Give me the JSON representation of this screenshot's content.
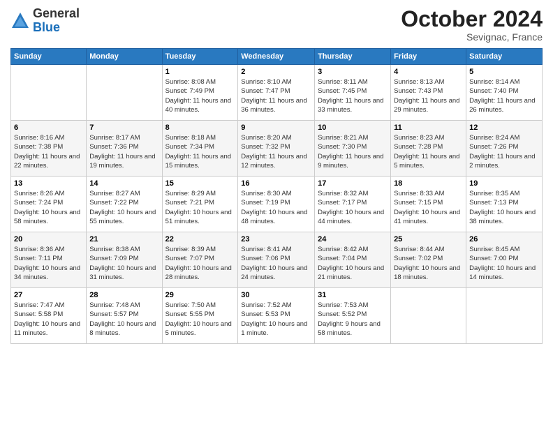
{
  "logo": {
    "general": "General",
    "blue": "Blue"
  },
  "title": "October 2024",
  "location": "Sevignac, France",
  "headers": [
    "Sunday",
    "Monday",
    "Tuesday",
    "Wednesday",
    "Thursday",
    "Friday",
    "Saturday"
  ],
  "weeks": [
    [
      {
        "day": "",
        "sunrise": "",
        "sunset": "",
        "daylight": ""
      },
      {
        "day": "",
        "sunrise": "",
        "sunset": "",
        "daylight": ""
      },
      {
        "day": "1",
        "sunrise": "Sunrise: 8:08 AM",
        "sunset": "Sunset: 7:49 PM",
        "daylight": "Daylight: 11 hours and 40 minutes."
      },
      {
        "day": "2",
        "sunrise": "Sunrise: 8:10 AM",
        "sunset": "Sunset: 7:47 PM",
        "daylight": "Daylight: 11 hours and 36 minutes."
      },
      {
        "day": "3",
        "sunrise": "Sunrise: 8:11 AM",
        "sunset": "Sunset: 7:45 PM",
        "daylight": "Daylight: 11 hours and 33 minutes."
      },
      {
        "day": "4",
        "sunrise": "Sunrise: 8:13 AM",
        "sunset": "Sunset: 7:43 PM",
        "daylight": "Daylight: 11 hours and 29 minutes."
      },
      {
        "day": "5",
        "sunrise": "Sunrise: 8:14 AM",
        "sunset": "Sunset: 7:40 PM",
        "daylight": "Daylight: 11 hours and 26 minutes."
      }
    ],
    [
      {
        "day": "6",
        "sunrise": "Sunrise: 8:16 AM",
        "sunset": "Sunset: 7:38 PM",
        "daylight": "Daylight: 11 hours and 22 minutes."
      },
      {
        "day": "7",
        "sunrise": "Sunrise: 8:17 AM",
        "sunset": "Sunset: 7:36 PM",
        "daylight": "Daylight: 11 hours and 19 minutes."
      },
      {
        "day": "8",
        "sunrise": "Sunrise: 8:18 AM",
        "sunset": "Sunset: 7:34 PM",
        "daylight": "Daylight: 11 hours and 15 minutes."
      },
      {
        "day": "9",
        "sunrise": "Sunrise: 8:20 AM",
        "sunset": "Sunset: 7:32 PM",
        "daylight": "Daylight: 11 hours and 12 minutes."
      },
      {
        "day": "10",
        "sunrise": "Sunrise: 8:21 AM",
        "sunset": "Sunset: 7:30 PM",
        "daylight": "Daylight: 11 hours and 9 minutes."
      },
      {
        "day": "11",
        "sunrise": "Sunrise: 8:23 AM",
        "sunset": "Sunset: 7:28 PM",
        "daylight": "Daylight: 11 hours and 5 minutes."
      },
      {
        "day": "12",
        "sunrise": "Sunrise: 8:24 AM",
        "sunset": "Sunset: 7:26 PM",
        "daylight": "Daylight: 11 hours and 2 minutes."
      }
    ],
    [
      {
        "day": "13",
        "sunrise": "Sunrise: 8:26 AM",
        "sunset": "Sunset: 7:24 PM",
        "daylight": "Daylight: 10 hours and 58 minutes."
      },
      {
        "day": "14",
        "sunrise": "Sunrise: 8:27 AM",
        "sunset": "Sunset: 7:22 PM",
        "daylight": "Daylight: 10 hours and 55 minutes."
      },
      {
        "day": "15",
        "sunrise": "Sunrise: 8:29 AM",
        "sunset": "Sunset: 7:21 PM",
        "daylight": "Daylight: 10 hours and 51 minutes."
      },
      {
        "day": "16",
        "sunrise": "Sunrise: 8:30 AM",
        "sunset": "Sunset: 7:19 PM",
        "daylight": "Daylight: 10 hours and 48 minutes."
      },
      {
        "day": "17",
        "sunrise": "Sunrise: 8:32 AM",
        "sunset": "Sunset: 7:17 PM",
        "daylight": "Daylight: 10 hours and 44 minutes."
      },
      {
        "day": "18",
        "sunrise": "Sunrise: 8:33 AM",
        "sunset": "Sunset: 7:15 PM",
        "daylight": "Daylight: 10 hours and 41 minutes."
      },
      {
        "day": "19",
        "sunrise": "Sunrise: 8:35 AM",
        "sunset": "Sunset: 7:13 PM",
        "daylight": "Daylight: 10 hours and 38 minutes."
      }
    ],
    [
      {
        "day": "20",
        "sunrise": "Sunrise: 8:36 AM",
        "sunset": "Sunset: 7:11 PM",
        "daylight": "Daylight: 10 hours and 34 minutes."
      },
      {
        "day": "21",
        "sunrise": "Sunrise: 8:38 AM",
        "sunset": "Sunset: 7:09 PM",
        "daylight": "Daylight: 10 hours and 31 minutes."
      },
      {
        "day": "22",
        "sunrise": "Sunrise: 8:39 AM",
        "sunset": "Sunset: 7:07 PM",
        "daylight": "Daylight: 10 hours and 28 minutes."
      },
      {
        "day": "23",
        "sunrise": "Sunrise: 8:41 AM",
        "sunset": "Sunset: 7:06 PM",
        "daylight": "Daylight: 10 hours and 24 minutes."
      },
      {
        "day": "24",
        "sunrise": "Sunrise: 8:42 AM",
        "sunset": "Sunset: 7:04 PM",
        "daylight": "Daylight: 10 hours and 21 minutes."
      },
      {
        "day": "25",
        "sunrise": "Sunrise: 8:44 AM",
        "sunset": "Sunset: 7:02 PM",
        "daylight": "Daylight: 10 hours and 18 minutes."
      },
      {
        "day": "26",
        "sunrise": "Sunrise: 8:45 AM",
        "sunset": "Sunset: 7:00 PM",
        "daylight": "Daylight: 10 hours and 14 minutes."
      }
    ],
    [
      {
        "day": "27",
        "sunrise": "Sunrise: 7:47 AM",
        "sunset": "Sunset: 5:58 PM",
        "daylight": "Daylight: 10 hours and 11 minutes."
      },
      {
        "day": "28",
        "sunrise": "Sunrise: 7:48 AM",
        "sunset": "Sunset: 5:57 PM",
        "daylight": "Daylight: 10 hours and 8 minutes."
      },
      {
        "day": "29",
        "sunrise": "Sunrise: 7:50 AM",
        "sunset": "Sunset: 5:55 PM",
        "daylight": "Daylight: 10 hours and 5 minutes."
      },
      {
        "day": "30",
        "sunrise": "Sunrise: 7:52 AM",
        "sunset": "Sunset: 5:53 PM",
        "daylight": "Daylight: 10 hours and 1 minute."
      },
      {
        "day": "31",
        "sunrise": "Sunrise: 7:53 AM",
        "sunset": "Sunset: 5:52 PM",
        "daylight": "Daylight: 9 hours and 58 minutes."
      },
      {
        "day": "",
        "sunrise": "",
        "sunset": "",
        "daylight": ""
      },
      {
        "day": "",
        "sunrise": "",
        "sunset": "",
        "daylight": ""
      }
    ]
  ]
}
